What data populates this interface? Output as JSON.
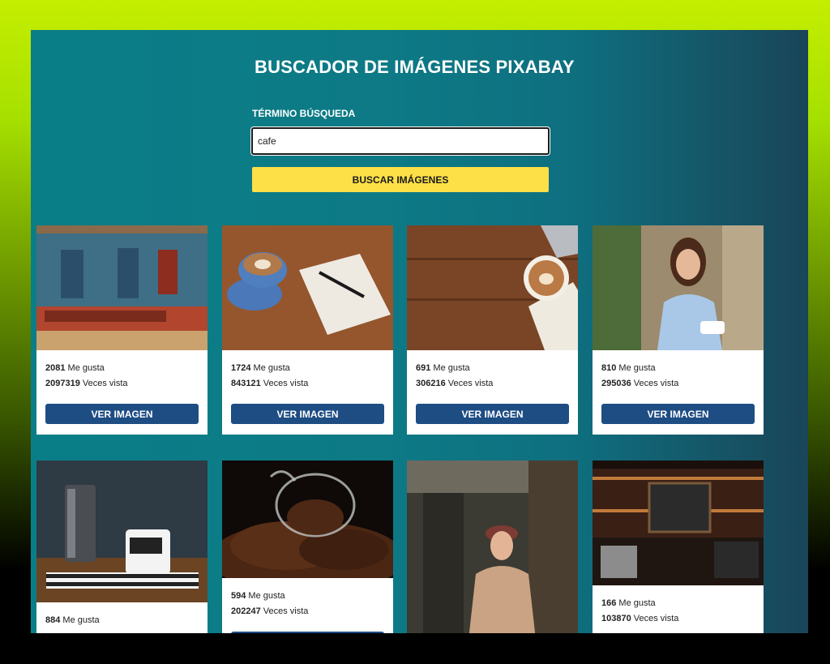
{
  "app": {
    "title": "BUSCADOR DE IMÁGENES PIXABAY"
  },
  "search": {
    "label": "TÉRMINO BÚSQUEDA",
    "value": "cafe",
    "button_label": "BUSCAR IMÁGENES"
  },
  "results": {
    "likes_label": "Me gusta",
    "views_label": "Veces vista",
    "button_label": "VER IMAGEN",
    "items": [
      {
        "likes": "2081",
        "views": "2097319",
        "subject": "cafe-street-facade"
      },
      {
        "likes": "1724",
        "views": "843121",
        "subject": "coffee-cup-notebook"
      },
      {
        "likes": "691",
        "views": "306216",
        "subject": "latte-on-wood-desk"
      },
      {
        "likes": "810",
        "views": "295036",
        "subject": "woman-phone-coffee"
      },
      {
        "likes": "884",
        "views": "",
        "subject": "moka-pot-coffee-mug"
      },
      {
        "likes": "594",
        "views": "202247",
        "subject": "coffee-beans-glass"
      },
      {
        "likes": "",
        "views": "",
        "subject": "woman-hat-coffee-shop"
      },
      {
        "likes": "166",
        "views": "103870",
        "subject": "coffee-bar-interior"
      }
    ]
  },
  "colors": {
    "accent_yellow": "#fde047",
    "button_blue": "#1e4d84",
    "panel_teal": "#0a7e87"
  }
}
